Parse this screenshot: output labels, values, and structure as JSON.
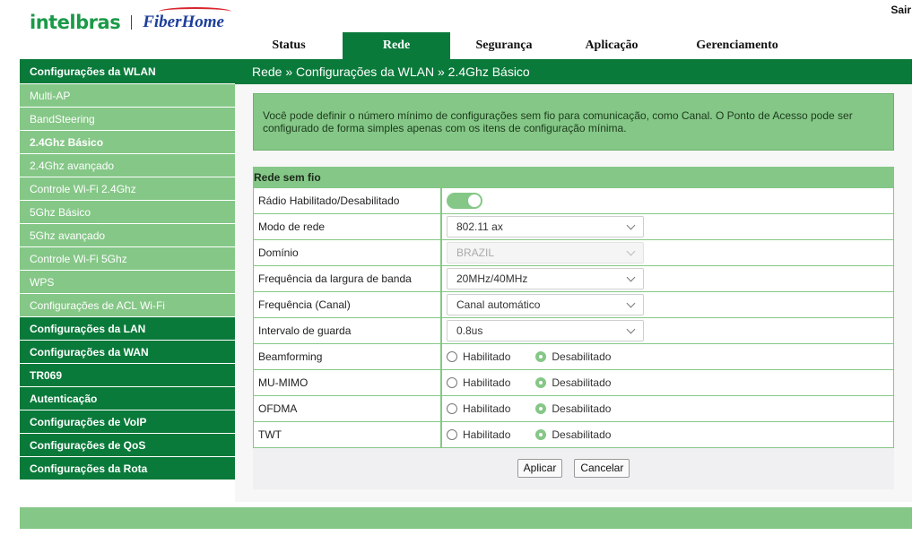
{
  "header": {
    "logo_left": "intelbras",
    "logo_right": "FiberHome",
    "logout": "Sair"
  },
  "topnav": {
    "tabs": [
      {
        "label": "Status"
      },
      {
        "label": "Rede"
      },
      {
        "label": "Segurança"
      },
      {
        "label": "Aplicação"
      },
      {
        "label": "Gerenciamento"
      }
    ],
    "active": "Rede"
  },
  "sidebar": {
    "section_wlan": "Configurações da WLAN",
    "wlan_items": [
      {
        "label": "Multi-AP"
      },
      {
        "label": "BandSteering"
      },
      {
        "label": "2.4Ghz Básico"
      },
      {
        "label": "2.4Ghz avançado"
      },
      {
        "label": "Controle Wi-Fi 2.4Ghz"
      },
      {
        "label": "5Ghz Básico"
      },
      {
        "label": "5Ghz avançado"
      },
      {
        "label": "Controle Wi-Fi 5Ghz"
      },
      {
        "label": "WPS"
      },
      {
        "label": "Configurações de ACL Wi-Fi"
      }
    ],
    "active_item": "2.4Ghz Básico",
    "sections": [
      {
        "label": "Configurações da LAN"
      },
      {
        "label": "Configurações da WAN"
      },
      {
        "label": "TR069"
      },
      {
        "label": "Autenticação"
      },
      {
        "label": "Configurações de VoIP"
      },
      {
        "label": "Configurações de QoS"
      },
      {
        "label": "Configurações da Rota"
      }
    ]
  },
  "breadcrumb": "Rede » Configurações da WLAN » 2.4Ghz Básico",
  "info_text": "Você pode definir o número mínimo de configurações sem fio para comunicação, como Canal. O Ponto de Acesso pode ser configurado de forma simples apenas com os itens de configuração mínima.",
  "panel": {
    "title": "Rede sem fio",
    "radio_label": "Rádio Habilitado/Desabilitado",
    "radio_enabled": true,
    "rows": {
      "mode": {
        "label": "Modo de rede",
        "value": "802.11 ax"
      },
      "domain": {
        "label": "Domínio",
        "value": "BRAZIL"
      },
      "bandwidth": {
        "label": "Frequência da largura de banda",
        "value": "20MHz/40MHz"
      },
      "channel": {
        "label": "Frequência (Canal)",
        "value": "Canal automático"
      },
      "guard": {
        "label": "Intervalo de guarda",
        "value": "0.8us"
      },
      "beamforming": {
        "label": "Beamforming"
      },
      "mumimo": {
        "label": "MU-MIMO"
      },
      "ofdma": {
        "label": "OFDMA"
      },
      "twt": {
        "label": "TWT"
      }
    },
    "option_enabled": "Habilitado",
    "option_disabled": "Desabilitado",
    "apply": "Aplicar",
    "cancel": "Cancelar"
  },
  "colors": {
    "dark_green": "#0a7a3a",
    "light_green": "#85c787"
  }
}
